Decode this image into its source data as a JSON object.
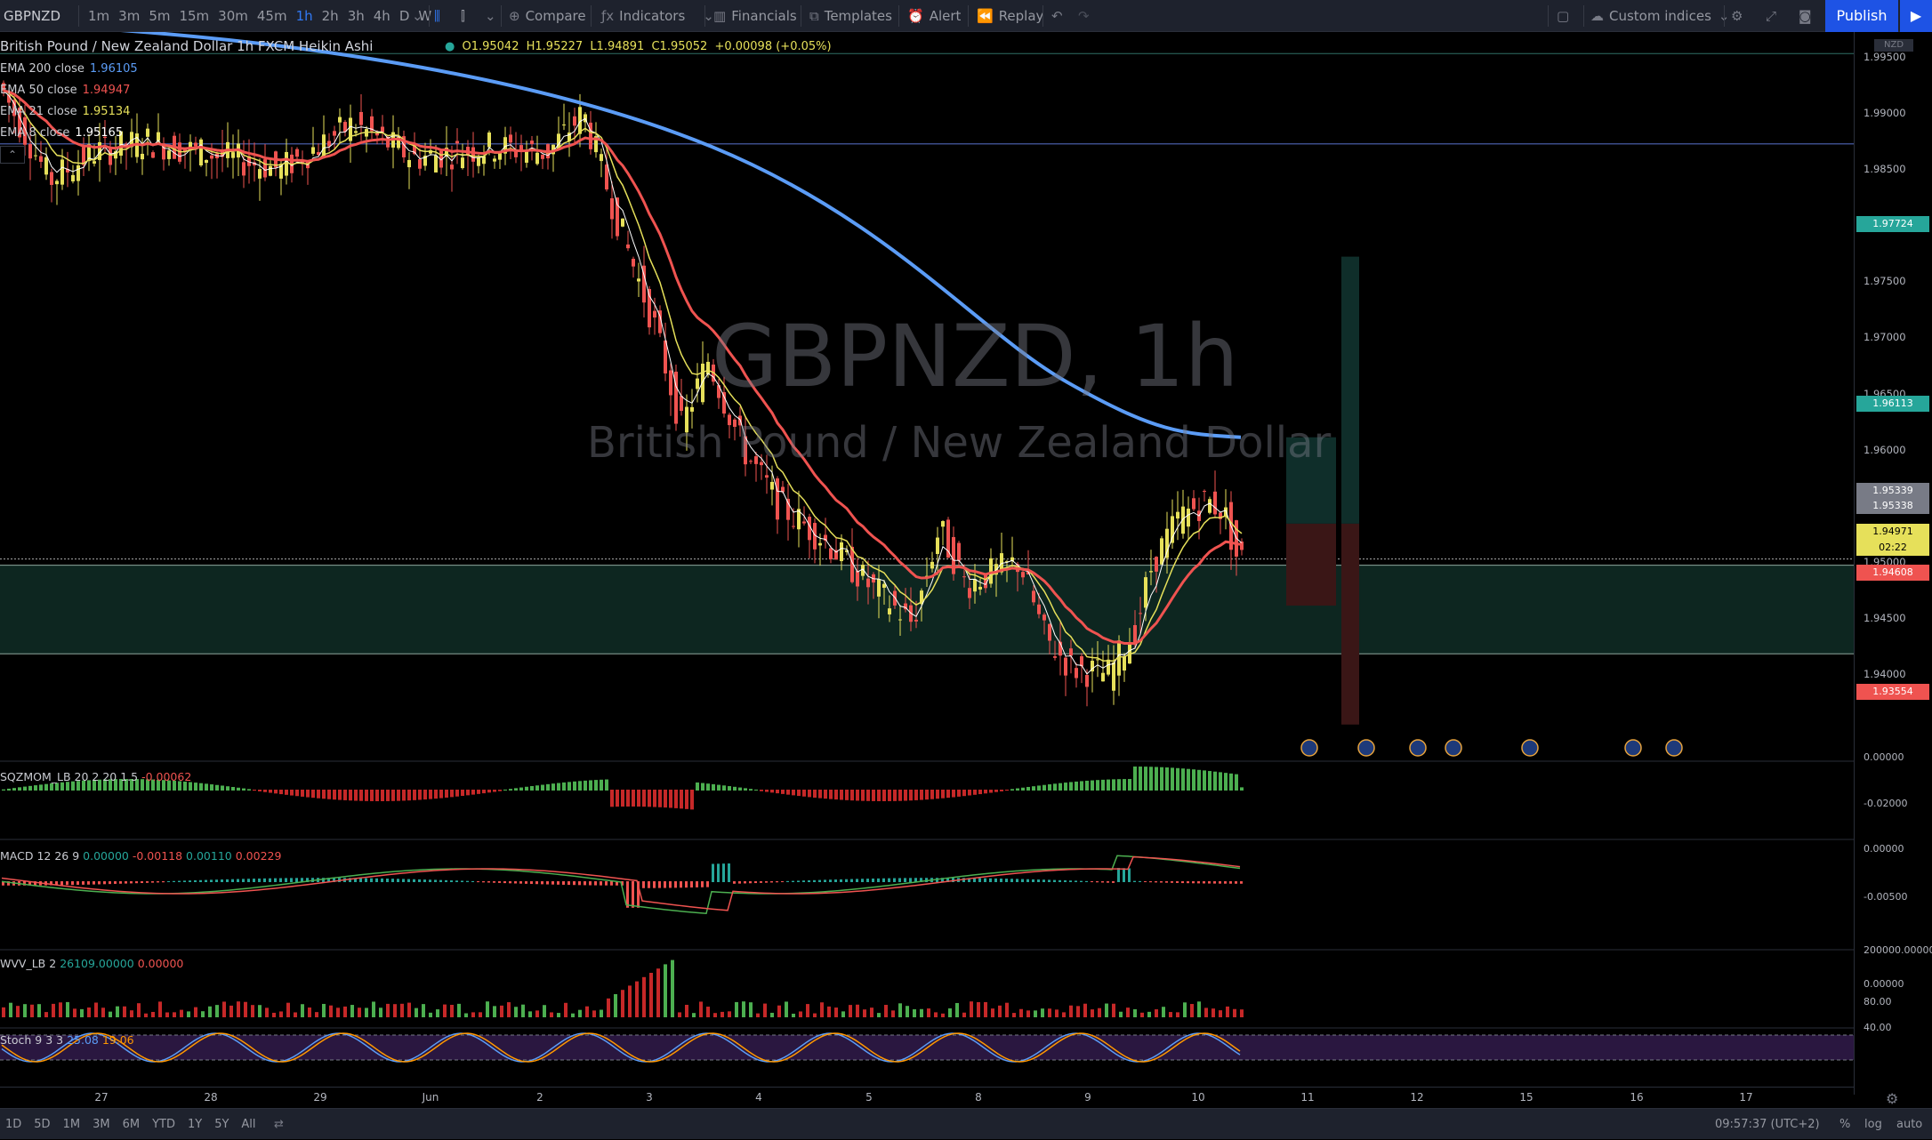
{
  "toolbar": {
    "symbol": "GBPNZD",
    "timeframes": [
      "1m",
      "3m",
      "5m",
      "15m",
      "30m",
      "45m",
      "1h",
      "2h",
      "3h",
      "4h",
      "D",
      "W"
    ],
    "active_timeframe": "1h",
    "compare_label": "Compare",
    "indicators_label": "Indicators",
    "financials_label": "Financials",
    "templates_label": "Templates",
    "alert_label": "Alert",
    "replay_label": "Replay",
    "custom_indices_label": "Custom indices",
    "publish_label": "Publish"
  },
  "chart": {
    "title": "British Pound / New Zealand Dollar  1h  FXCM  Heikin Ashi",
    "ohlc": {
      "o": "O1.95042",
      "h": "H1.95227",
      "l": "L1.94891",
      "c": "C1.95052",
      "chg": "+0.00098 (+0.05%)"
    },
    "watermark_symbol": "GBPNZD, 1h",
    "watermark_name": "British Pound / New Zealand Dollar",
    "currency": "NZD",
    "emas": [
      {
        "label": "EMA 200 close",
        "value": "1.96105",
        "color": "#5b9cf6"
      },
      {
        "label": "EMA 50 close",
        "value": "1.94947",
        "color": "#ef5350"
      },
      {
        "label": "EMA 21 close",
        "value": "1.95134",
        "color": "#e6e05a"
      },
      {
        "label": "EMA 8 close",
        "value": "1.95165",
        "color": "#ffffff"
      }
    ],
    "price_ticks": [
      "1.99500",
      "1.99000",
      "1.98500",
      "1.98000",
      "1.97500",
      "1.97000",
      "1.96500",
      "1.96000",
      "1.95500",
      "1.95000",
      "1.94500",
      "1.94000"
    ],
    "price_labels": [
      {
        "text": "1.97724",
        "color": "#26a69a"
      },
      {
        "text": "1.96113",
        "color": "#26a69a"
      },
      {
        "text": "1.95339",
        "color": "#787b86"
      },
      {
        "text": "1.95338",
        "color": "#787b86"
      },
      {
        "text": "1.94971",
        "color": "#e6e05a"
      },
      {
        "text": "02:22",
        "color": "#e6e05a"
      },
      {
        "text": "1.94608",
        "color": "#ef5350"
      },
      {
        "text": "1.93554",
        "color": "#ef5350"
      }
    ]
  },
  "indicators": {
    "sqz": {
      "name": "SQZMOM_LB",
      "params": "20 2 20 1.5",
      "value": "-0.00062",
      "ticks": [
        "0.00000",
        "-0.02000"
      ]
    },
    "macd": {
      "name": "MACD",
      "params": "12 26 9",
      "v1": "0.00000",
      "v2": "-0.00118",
      "v3": "0.00110",
      "v4": "0.00229",
      "ticks": [
        "0.00000",
        "-0.00500"
      ]
    },
    "wvv": {
      "name": "WVV_LB",
      "params": "2",
      "v1": "26109.00000",
      "v2": "0.00000",
      "ticks": [
        "200000.00000",
        "0.00000"
      ]
    },
    "stoch": {
      "name": "Stoch",
      "params": "9 3 3",
      "k": "25.08",
      "d": "19.06",
      "ticks": [
        "80.00",
        "40.00"
      ]
    }
  },
  "time_axis": [
    "27",
    "28",
    "29",
    "Jun",
    "2",
    "3",
    "4",
    "5",
    "8",
    "9",
    "10",
    "11",
    "12",
    "15",
    "16",
    "17"
  ],
  "bottom_bar": {
    "ranges": [
      "1D",
      "5D",
      "1M",
      "3M",
      "6M",
      "YTD",
      "1Y",
      "5Y",
      "All"
    ],
    "clock": "09:57:37 (UTC+2)",
    "percent": "%",
    "log": "log",
    "auto": "auto"
  }
}
